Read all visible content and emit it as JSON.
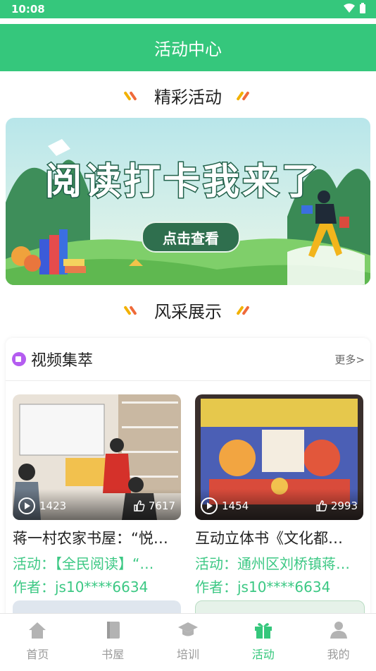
{
  "status": {
    "time": "10:08"
  },
  "header": {
    "title": "活动中心"
  },
  "sections": {
    "featured": "精彩活动",
    "showcase": "风采展示"
  },
  "banner": {
    "headline": "阅读打卡我来了",
    "button": "点击查看"
  },
  "videos_card": {
    "title": "视频集萃",
    "more": "更多>",
    "items": [
      {
        "views": "1423",
        "likes": "7617",
        "title": "蒋一村农家书屋：“悦…",
        "activity": "活动：【全民阅读】“…",
        "author": "作者：js10****6634"
      },
      {
        "views": "1454",
        "likes": "2993",
        "title": "互动立体书《文化都…",
        "activity": "活动：通州区刘桥镇蒋…",
        "author": "作者：js10****6634"
      }
    ]
  },
  "tabbar": {
    "items": [
      {
        "label": "首页",
        "icon": "home-icon"
      },
      {
        "label": "书屋",
        "icon": "book-icon"
      },
      {
        "label": "培训",
        "icon": "graduation-cap-icon"
      },
      {
        "label": "活动",
        "icon": "gift-icon"
      },
      {
        "label": "我的",
        "icon": "user-icon"
      }
    ],
    "active": "活动"
  },
  "colors": {
    "brand": "#35c77c",
    "text_green": "#3cc884"
  }
}
